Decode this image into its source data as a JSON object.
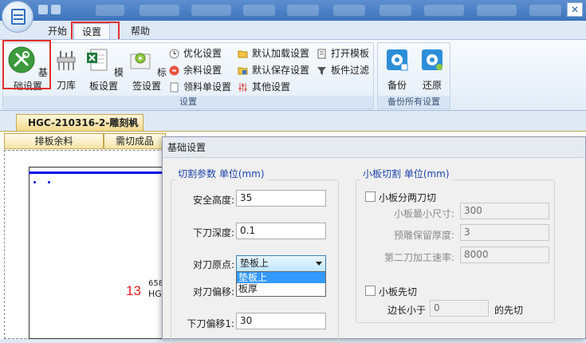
{
  "window": {
    "close_glyph": "✕"
  },
  "ribbon_tabs": {
    "start": "开始",
    "settings": "设置",
    "help": "帮助"
  },
  "ribbon": {
    "group_settings": {
      "label": "设置",
      "basic_settings": "基础设置",
      "tool_library": "刀库",
      "template_settings": "模板设置",
      "label_settings": "标签设置",
      "optimize_settings": "优化设置",
      "remnant_settings": "余料设置",
      "picking_list_settings": "领料单设置",
      "default_load_settings": "默认加载设置",
      "default_save_settings": "默认保存设置",
      "other_settings": "其他设置",
      "open_template": "打开模板",
      "panel_filter": "板件过滤"
    },
    "group_backup": {
      "label": "备份所有设置",
      "backup": "备份",
      "restore": "还原"
    }
  },
  "document": {
    "tab_title": "HGC-210316-2-雕刻机",
    "tab_close": "✕",
    "subtabs": [
      "排板余料",
      "需切成品"
    ],
    "part_number": "13",
    "part_text_1": "658",
    "part_text_2": "HG"
  },
  "dialog": {
    "title": "基础设置",
    "cut_params": {
      "legend": "切割参数 单位(mm)",
      "safe_height_label": "安全高度:",
      "safe_height_value": "35",
      "cut_depth_label": "下刀深度:",
      "cut_depth_value": "0.1",
      "tool_origin_label": "对刀原点:",
      "tool_origin_selected": "垫板上",
      "tool_origin_options": [
        "垫板上",
        "板厚"
      ],
      "tool_offset_label": "对刀偏移:",
      "down_offset_label": "下刀偏移1:",
      "down_offset_value": "30"
    },
    "small_panel": {
      "legend": "小板切割 单位(mm)",
      "two_cut_label": "小板分两刀切",
      "min_size_label": "小板最小尺寸:",
      "min_size_value": "300",
      "reserve_thickness_label": "预雕保留厚度:",
      "reserve_thickness_value": "3",
      "second_speed_label": "第二刀加工速率:",
      "second_speed_value": "8000",
      "cut_first_label": "小板先切",
      "edge_less_label": "边长小于",
      "edge_less_value": "0",
      "cut_first_suffix": "的先切"
    }
  },
  "colors": {
    "highlight_box": "#e0302c",
    "legend_blue": "#1c44a8",
    "part_number_red": "#e02020",
    "selected_option": "#3399ff"
  }
}
